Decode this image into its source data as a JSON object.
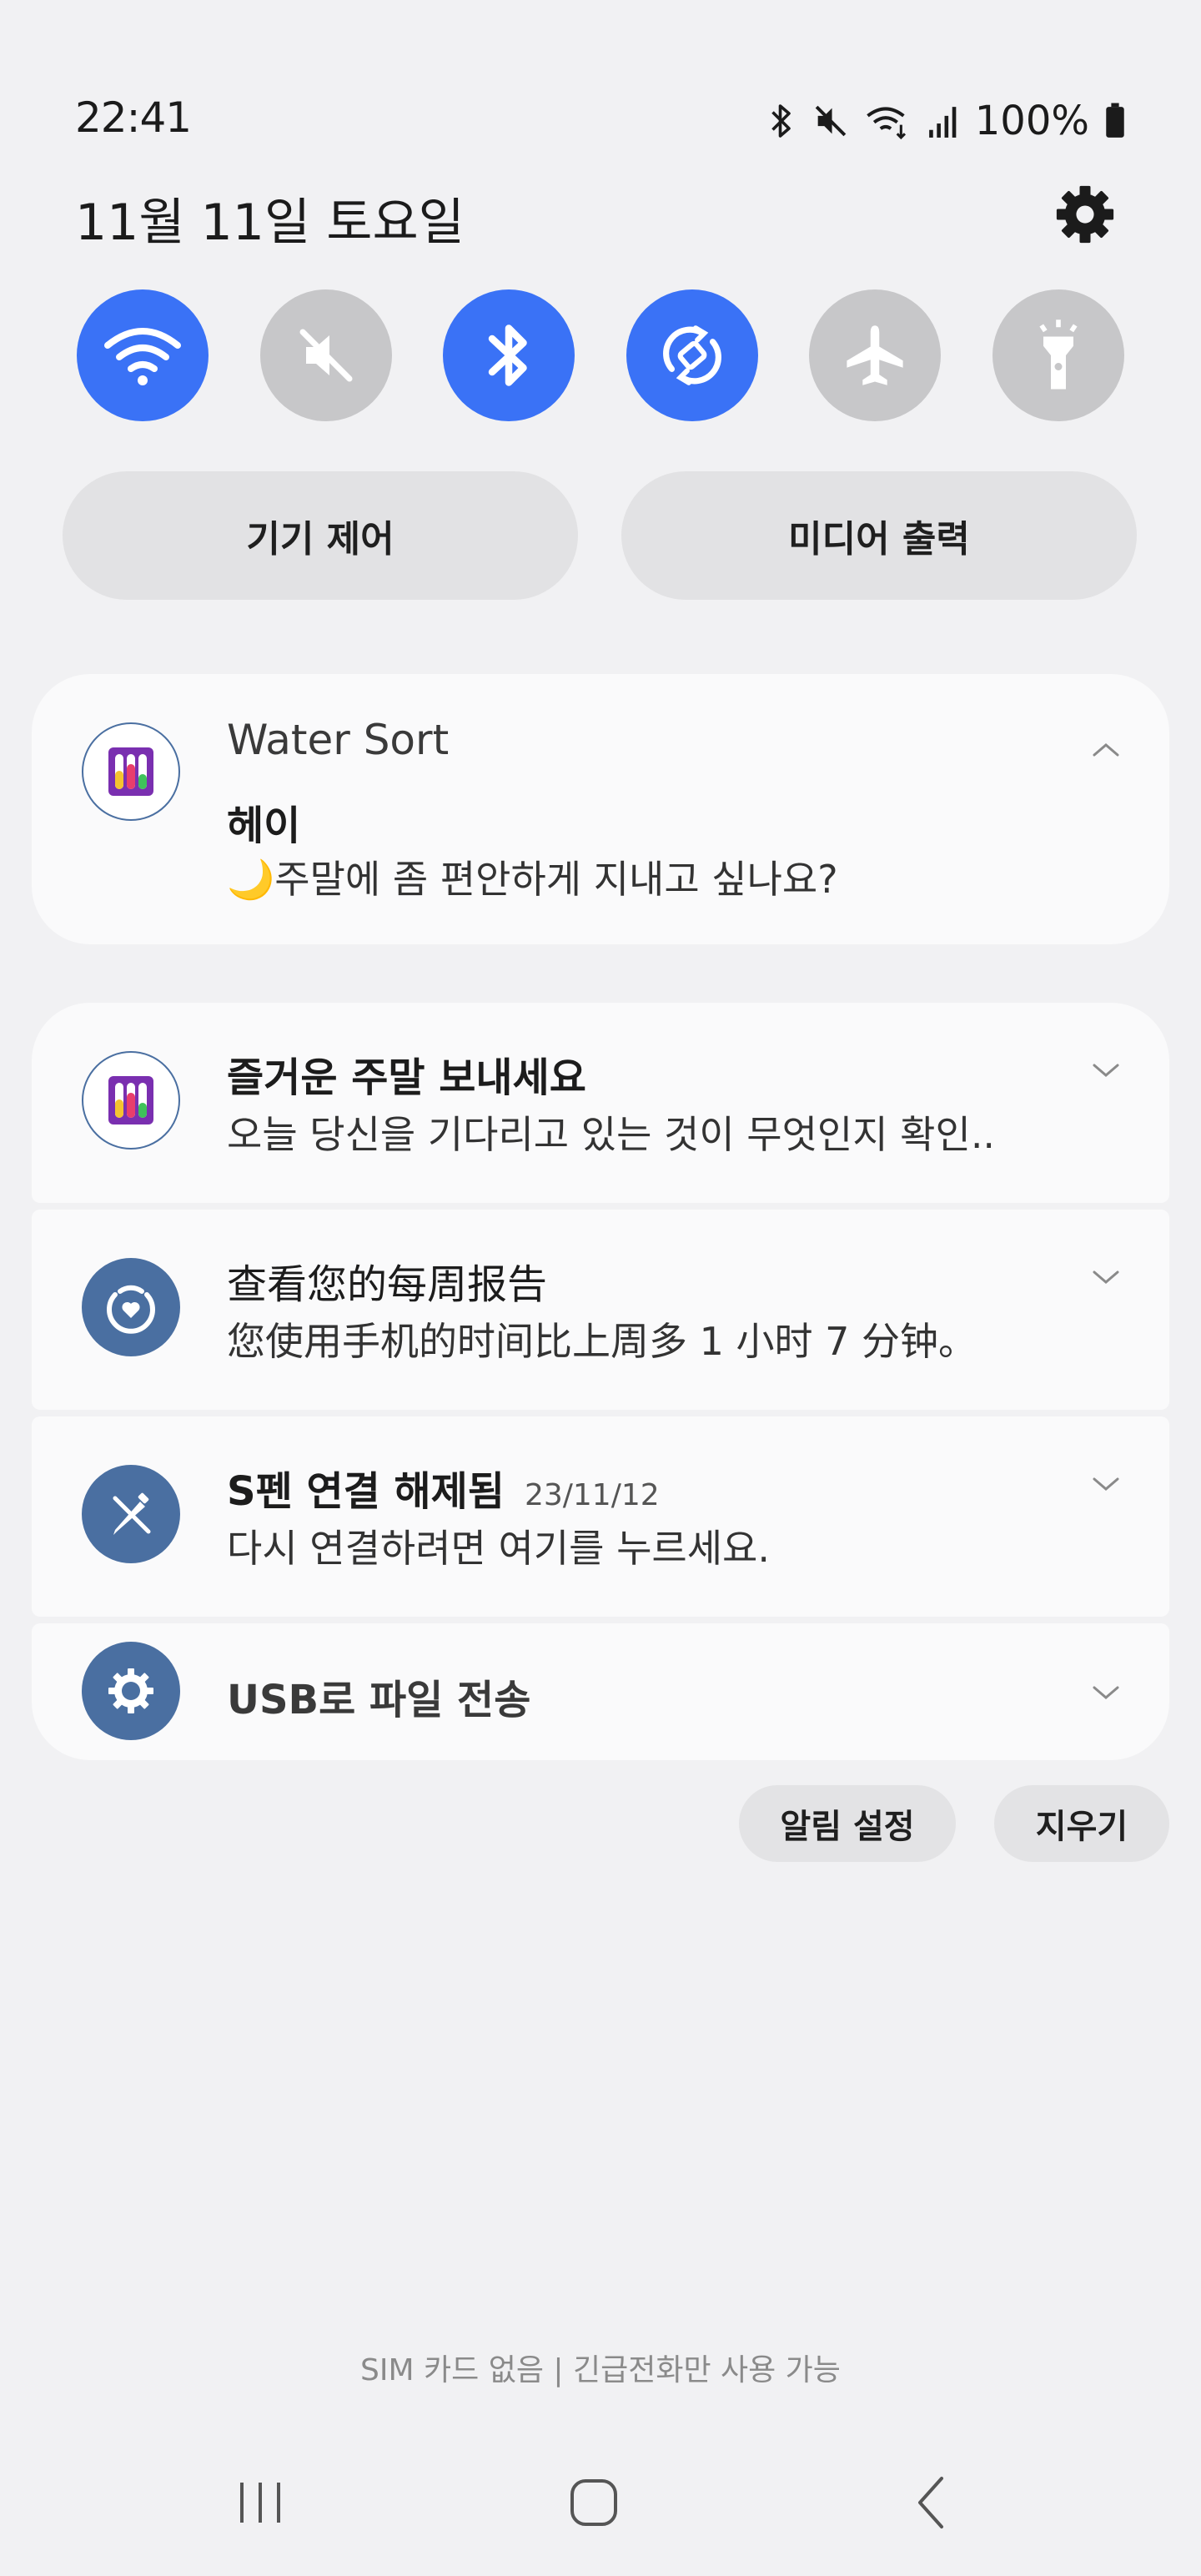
{
  "status_bar": {
    "time": "22:41",
    "battery": "100%"
  },
  "header": {
    "date": "11월 11일 토요일"
  },
  "quick_toggles": [
    {
      "icon": "wifi-icon",
      "state": "on"
    },
    {
      "icon": "mute-icon",
      "state": "off"
    },
    {
      "icon": "bluetooth-icon",
      "state": "on"
    },
    {
      "icon": "auto-rotate-icon",
      "state": "on"
    },
    {
      "icon": "airplane-icon",
      "state": "off"
    },
    {
      "icon": "flashlight-icon",
      "state": "off"
    }
  ],
  "controls": {
    "device_control": "기기 제어",
    "media_output": "미디어 출력"
  },
  "notifications": {
    "water_sort": {
      "app": "Water Sort",
      "title": "헤이",
      "body": "🌙주말에 좀 편안하게 지내고 싶나요?"
    },
    "weekend": {
      "title": "즐거운 주말 보내세요",
      "body": "오늘 당신을 기다리고 있는 것이 무엇인지 확인.."
    },
    "report": {
      "title": "查看您的每周报告",
      "body": "您使用手机的时间比上周多 1 小时 7 分钟。"
    },
    "spen": {
      "title": "S펜 연결 해제됨",
      "date": "23/11/12",
      "body": "다시 연결하려면 여기를 누르세요."
    },
    "usb": {
      "title": "USB로 파일 전송"
    }
  },
  "actions": {
    "notification_settings": "알림 설정",
    "clear": "지우기"
  },
  "footer": {
    "sim_status": "SIM 카드 없음 | 긴급전화만 사용 가능"
  },
  "colors": {
    "accent": "#3a72f6",
    "toggle_off": "#c7c7c9",
    "system_icon_bg": "#4a6fa1"
  }
}
